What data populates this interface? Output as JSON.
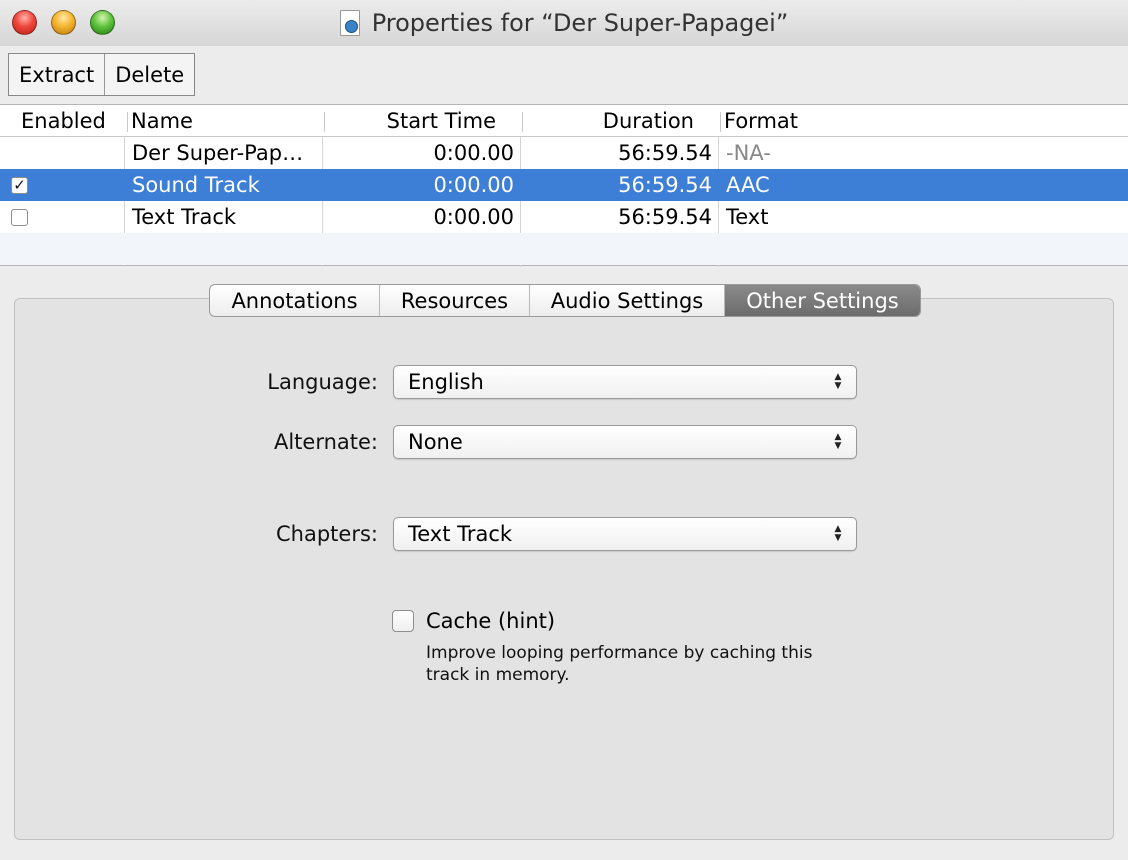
{
  "window": {
    "title": "Properties for “Der Super-Papagei”",
    "title_icon": "document-icon"
  },
  "toolbar": {
    "extract_label": "Extract",
    "delete_label": "Delete"
  },
  "tracks_table": {
    "columns": [
      "Enabled",
      "Name",
      "Start Time",
      "Duration",
      "Format"
    ],
    "rows": [
      {
        "enabled": null,
        "name": "Der Super-Pap…",
        "start_time": "0:00.00",
        "duration": "56:59.54",
        "format": "-NA-"
      },
      {
        "enabled": true,
        "name": "Sound Track",
        "start_time": "0:00.00",
        "duration": "56:59.54",
        "format": "AAC",
        "selected": true
      },
      {
        "enabled": false,
        "name": "Text Track",
        "start_time": "0:00.00",
        "duration": "56:59.54",
        "format": "Text"
      }
    ]
  },
  "tabs": [
    {
      "label": "Annotations",
      "active": false
    },
    {
      "label": "Resources",
      "active": false
    },
    {
      "label": "Audio Settings",
      "active": false
    },
    {
      "label": "Other Settings",
      "active": true
    }
  ],
  "other_settings": {
    "language_label": "Language:",
    "language_value": "English",
    "alternate_label": "Alternate:",
    "alternate_value": "None",
    "chapters_label": "Chapters:",
    "chapters_value": "Text Track",
    "cache_label": "Cache (hint)",
    "cache_checked": false,
    "cache_help": "Improve looping performance by caching this track in memory."
  },
  "colors": {
    "selection": "#3d7ed6",
    "active_tab": "#7a7a7a",
    "panel": "#e3e3e3"
  }
}
